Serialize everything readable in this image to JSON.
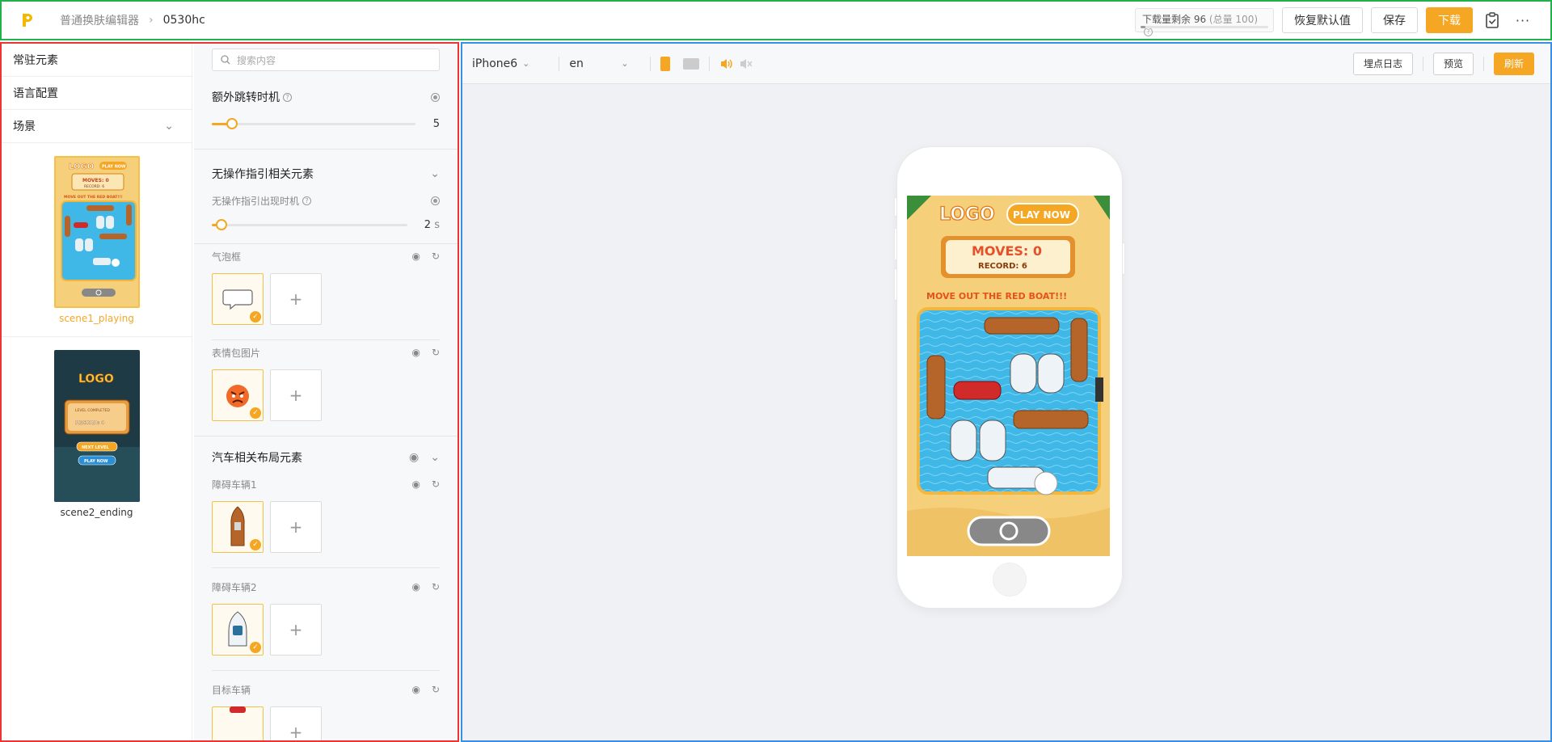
{
  "header": {
    "breadcrumb_root": "普通换肤编辑器",
    "breadcrumb_current": "0530hc",
    "quota_text": "下载量剩余 96",
    "quota_total": "(总量 100)",
    "quota_fraction": 0.04,
    "restore_label": "恢复默认值",
    "save_label": "保存",
    "download_label": "下载",
    "more_label": "···"
  },
  "sidebar": {
    "items": [
      {
        "label": "常驻元素"
      },
      {
        "label": "语言配置"
      },
      {
        "label": "场景"
      }
    ],
    "scenes": [
      {
        "label": "scene1_playing",
        "active": true
      },
      {
        "label": "scene2_ending",
        "active": false
      }
    ]
  },
  "search": {
    "placeholder": "搜索内容"
  },
  "props": {
    "extra_jump": {
      "label": "额外跳转时机",
      "value": "5",
      "fraction": 0.1
    },
    "idle_group": {
      "label": "无操作指引相关元素"
    },
    "idle_time": {
      "label": "无操作指引出现时机",
      "value": "2",
      "unit": "s",
      "fraction": 0.05
    },
    "bubble": {
      "label": "气泡框"
    },
    "emoji": {
      "label": "表情包图片"
    },
    "car_group": {
      "label": "汽车相关布局元素"
    },
    "obstacle1": {
      "label": "障碍车辆1"
    },
    "obstacle2": {
      "label": "障碍车辆2"
    },
    "target": {
      "label": "目标车辆"
    },
    "add_label": "+"
  },
  "preview": {
    "device": "iPhone6",
    "language": "en",
    "log_label": "埋点日志",
    "preview_label": "预览",
    "refresh_label": "刷新",
    "game": {
      "logo": "LOGO",
      "play_now": "PLAY NOW",
      "moves": "MOVES: 0",
      "record": "RECORD: 6",
      "instruction": "MOVE OUT THE RED BOAT!!!"
    },
    "thumb2": {
      "logo": "LOGO",
      "level_completed": "LEVEL COMPLETED",
      "record": "RECORD: 0",
      "next_level": "NEXT LEVEL",
      "play_now": "PLAY NOW"
    }
  },
  "colors": {
    "accent": "#f5a623",
    "water": "#3fb8e8",
    "sand": "#f6cf7a"
  }
}
